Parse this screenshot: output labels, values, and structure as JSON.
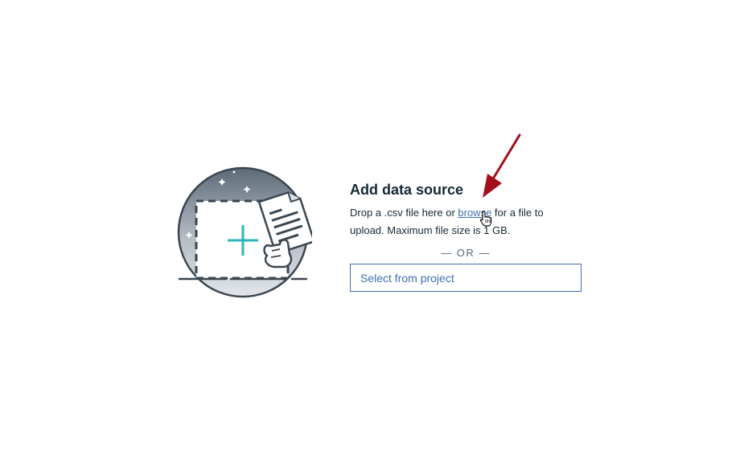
{
  "upload_panel": {
    "title": "Add data source",
    "description_before_link": "Drop a .csv file here or ",
    "browse_link": "browse",
    "description_after_link": " for a file to upload. Maximum file size is 1 GB.",
    "or_divider": "— OR —",
    "select_button": "Select from project"
  },
  "illustration": {
    "icon": "upload-file-illustration",
    "plus_color": "#2ab6b9"
  },
  "annotation": {
    "icon": "red-arrow-annotation",
    "color": "#a3101d"
  },
  "cursor": {
    "icon": "hand-pointer-cursor"
  },
  "colors": {
    "link": "#3d70b2",
    "text": "#152935"
  }
}
